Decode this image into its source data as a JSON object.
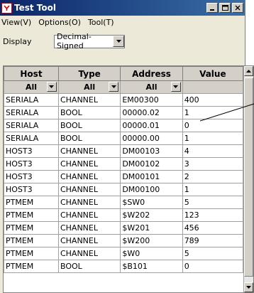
{
  "window": {
    "title": "Test Tool"
  },
  "menu": [
    {
      "label": "View(V)"
    },
    {
      "label": "Options(O)"
    },
    {
      "label": "Tool(T)"
    }
  ],
  "display": {
    "label": "Display",
    "value": "Decimal-Signed"
  },
  "table": {
    "headers": [
      "Host",
      "Type",
      "Address",
      "Value"
    ],
    "filters": [
      "All",
      "All",
      "All"
    ],
    "rows": [
      [
        "SERIALA",
        "CHANNEL",
        "EM00300",
        "400"
      ],
      [
        "SERIALA",
        "BOOL",
        "00000.02",
        "1"
      ],
      [
        "SERIALA",
        "BOOL",
        "00000.01",
        "0"
      ],
      [
        "SERIALA",
        "BOOL",
        "00000.00",
        "1"
      ],
      [
        "HOST3",
        "CHANNEL",
        "DM00103",
        "4"
      ],
      [
        "HOST3",
        "CHANNEL",
        "DM00102",
        "3"
      ],
      [
        "HOST3",
        "CHANNEL",
        "DM00101",
        "2"
      ],
      [
        "HOST3",
        "CHANNEL",
        "DM00100",
        "1"
      ],
      [
        "PTMEM",
        "CHANNEL",
        "$SW0",
        "5"
      ],
      [
        "PTMEM",
        "CHANNEL",
        "$W202",
        "123"
      ],
      [
        "PTMEM",
        "CHANNEL",
        "$W201",
        "456"
      ],
      [
        "PTMEM",
        "CHANNEL",
        "$W200",
        "789"
      ],
      [
        "PTMEM",
        "CHANNEL",
        "$W0",
        "5"
      ],
      [
        "PTMEM",
        "BOOL",
        "$B101",
        "0"
      ]
    ]
  }
}
